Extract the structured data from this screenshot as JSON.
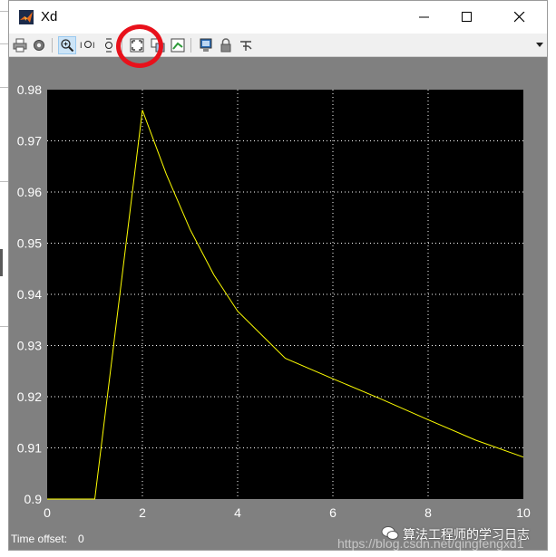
{
  "window": {
    "title": "Xd",
    "controls": {
      "minimize": "minimize",
      "maximize": "maximize",
      "close": "close"
    }
  },
  "toolbar": {
    "buttons": [
      {
        "name": "print",
        "icon": "printer-icon"
      },
      {
        "name": "parameters",
        "icon": "gear-icon"
      },
      {
        "name": "zoom",
        "icon": "zoom-in-icon",
        "active": true
      },
      {
        "name": "zoom-x",
        "icon": "zoom-x-icon"
      },
      {
        "name": "zoom-y",
        "icon": "zoom-y-icon"
      },
      {
        "name": "autoscale",
        "icon": "autoscale-icon"
      },
      {
        "name": "save-axes",
        "icon": "save-axes-icon"
      },
      {
        "name": "restore-axes",
        "icon": "restore-axes-icon"
      },
      {
        "name": "floating-scope",
        "icon": "floating-scope-icon"
      },
      {
        "name": "lock-axes",
        "icon": "lock-icon"
      },
      {
        "name": "signal-selector",
        "icon": "signal-selector-icon"
      }
    ],
    "overflow_icon": "chevron-down-icon"
  },
  "colors": {
    "plot_background": "#000000",
    "figure_background": "#808080",
    "grid": "#ffffff",
    "trace": "#ffff00",
    "annotation": "#e8111b"
  },
  "chart_data": {
    "type": "line",
    "title": "",
    "xlabel": "",
    "ylabel": "",
    "xlim": [
      0,
      10
    ],
    "ylim": [
      0.9,
      0.98
    ],
    "grid": true,
    "x_ticks": [
      "0",
      "2",
      "4",
      "6",
      "8",
      "10"
    ],
    "y_ticks": [
      "0.9",
      "0.91",
      "0.92",
      "0.93",
      "0.94",
      "0.95",
      "0.96",
      "0.97",
      "0.98"
    ],
    "series": [
      {
        "color": "#ffff00",
        "x": [
          0,
          1,
          2,
          2.5,
          3,
          3.5,
          4,
          5,
          6,
          7,
          8,
          9,
          10
        ],
        "y": [
          0.9,
          0.9,
          0.976,
          0.9635,
          0.9527,
          0.9438,
          0.9367,
          0.9275,
          0.9235,
          0.9196,
          0.9155,
          0.9115,
          0.9082
        ]
      }
    ]
  },
  "status": {
    "time_offset_label": "Time offset:",
    "time_offset_value": "0"
  },
  "watermark": {
    "text": "算法工程师的学习日志",
    "url": "https://blog.csdn.net/qingfengxd1",
    "icon": "wechat-icon"
  }
}
